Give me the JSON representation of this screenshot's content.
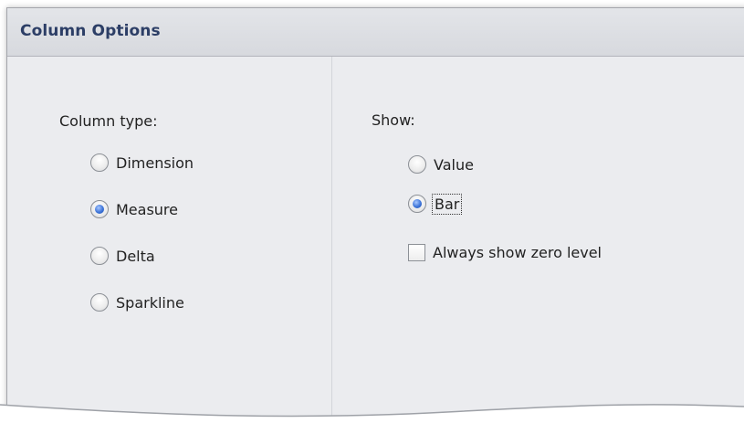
{
  "dialog": {
    "title": "Column Options"
  },
  "column_type": {
    "label": "Column type:",
    "options": [
      {
        "label": "Dimension",
        "checked": false
      },
      {
        "label": "Measure",
        "checked": true
      },
      {
        "label": "Delta",
        "checked": false
      },
      {
        "label": "Sparkline",
        "checked": false
      }
    ]
  },
  "show": {
    "label": "Show:",
    "options": [
      {
        "label": "Value",
        "checked": false
      },
      {
        "label": "Bar",
        "checked": true
      }
    ],
    "zero_level": {
      "label": "Always show zero level",
      "checked": false
    }
  },
  "colors": {
    "title_text": "#2c3e66",
    "panel_bg": "#ebecef",
    "radio_checked": "#3d74d8"
  }
}
